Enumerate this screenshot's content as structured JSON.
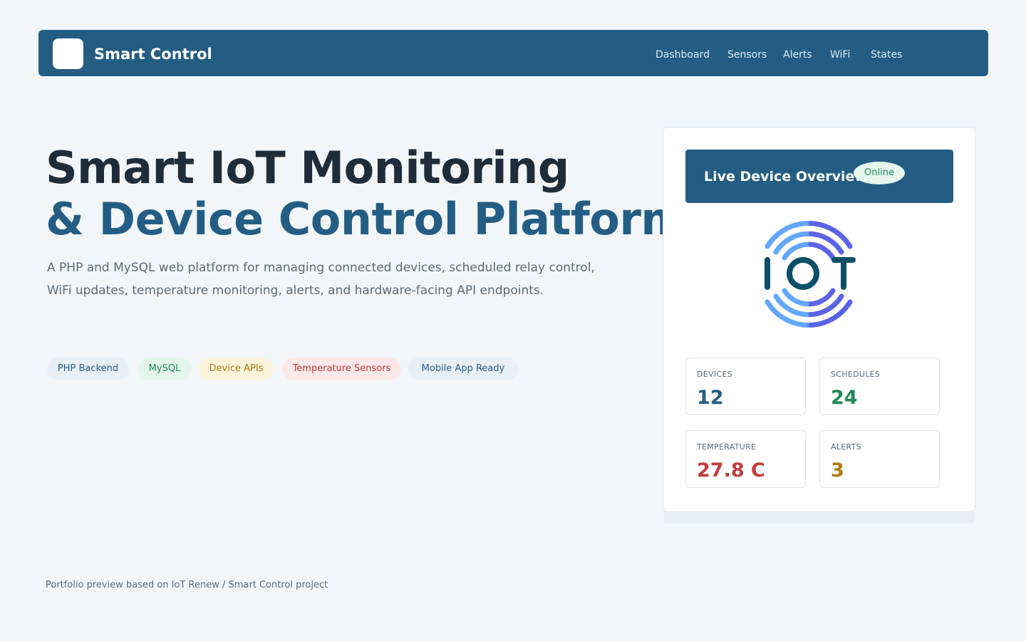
{
  "navbar": {
    "brand": "Smart Control",
    "links": [
      "Dashboard",
      "Sensors",
      "Alerts",
      "WiFi",
      "States"
    ]
  },
  "hero": {
    "title_line1": "Smart IoT Monitoring",
    "title_line2": "& Device Control Platform",
    "description": "A PHP and MySQL web platform for managing connected devices, scheduled relay control, WiFi updates, temperature monitoring, alerts, and hardware-facing API endpoints.",
    "tags": [
      {
        "label": "PHP Backend",
        "bg": "#e8f0f6",
        "color": "#245d84"
      },
      {
        "label": "MySQL",
        "bg": "#e4f5ec",
        "color": "#218857"
      },
      {
        "label": "Device APIs",
        "bg": "#fbf4da",
        "color": "#a37a12"
      },
      {
        "label": "Temperature Sensors",
        "bg": "#fde8e8",
        "color": "#c33c3c"
      },
      {
        "label": "Mobile App Ready",
        "bg": "#e8f0f6",
        "color": "#245d84"
      }
    ]
  },
  "card": {
    "title": "Live Device Overview",
    "status": "Online",
    "logo_icon": "iot-signal-logo",
    "stats": [
      {
        "label": "DEVICES",
        "value": "12",
        "color": "#245d84"
      },
      {
        "label": "SCHEDULES",
        "value": "24",
        "color": "#218857"
      },
      {
        "label": "TEMPERATURE",
        "value": "27.8 C",
        "color": "#c33c3c"
      },
      {
        "label": "ALERTS",
        "value": "3",
        "color": "#b07d10"
      }
    ]
  },
  "footer": {
    "note": "Portfolio preview based on IoT Renew / Smart Control project"
  }
}
